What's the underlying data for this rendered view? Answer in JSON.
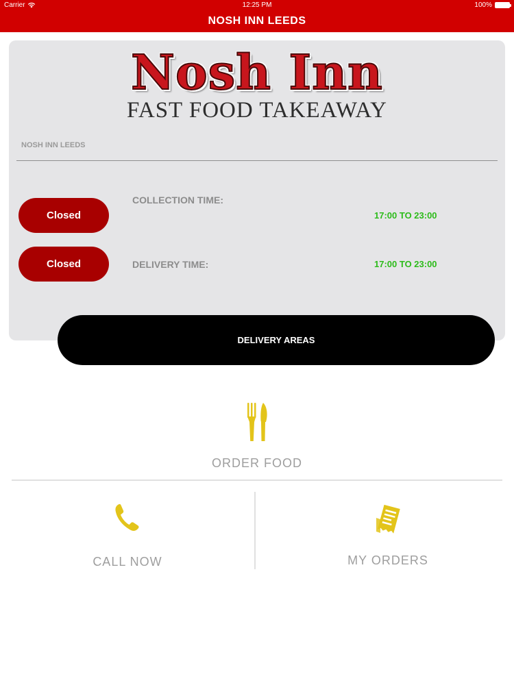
{
  "status_bar": {
    "carrier": "Carrier",
    "time": "12:25 PM",
    "battery": "100%"
  },
  "header": {
    "title": "NOSH INN LEEDS"
  },
  "logo": {
    "title": "Nosh Inn",
    "subtitle": "FAST FOOD TAKEAWAY"
  },
  "store": {
    "name": "NOSH INN LEEDS"
  },
  "collection": {
    "status": "Closed",
    "label": "COLLECTION TIME:",
    "hours": "17:00 TO 23:00"
  },
  "delivery": {
    "status": "Closed",
    "label": "DELIVERY TIME:",
    "hours": "17:00 TO 23:00"
  },
  "actions": {
    "delivery_areas": "DELIVERY AREAS",
    "order_food": "ORDER FOOD",
    "call_now": "CALL NOW",
    "my_orders": "MY ORDERS"
  },
  "colors": {
    "header": "#d10000",
    "status_closed": "#a80000",
    "hours": "#2cbb1a",
    "icon_accent": "#e3c41a"
  },
  "icons": {
    "order_food": "fork-knife-icon",
    "call_now": "phone-icon",
    "my_orders": "receipt-icon",
    "wifi": "wifi-icon",
    "battery": "battery-icon"
  }
}
